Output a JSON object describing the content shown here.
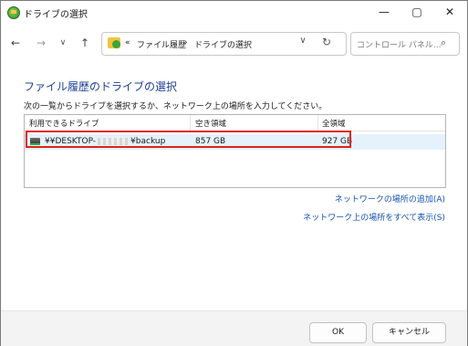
{
  "window": {
    "title": "ドライブの選択"
  },
  "nav": {
    "address_prefix": "«",
    "breadcrumb": [
      "ファイル履歴",
      "ドライブの選択"
    ],
    "breadcrumb_sep": "›",
    "search_placeholder": "コントロール パネル..."
  },
  "main": {
    "heading": "ファイル履歴のドライブの選択",
    "instruction": "次の一覧からドライブを選択するか、ネットワーク上の場所を入力してください。",
    "columns": [
      "利用できるドライブ",
      "空き領域",
      "全領域"
    ],
    "rows": [
      {
        "name_prefix": "¥¥DESKTOP-",
        "name_suffix": "¥backup",
        "free": "857 GB",
        "total": "927 GB"
      }
    ]
  },
  "links": {
    "add_network": "ネットワークの場所の追加(A)",
    "show_all_network": "ネットワーク上の場所をすべて表示(S)"
  },
  "footer": {
    "ok": "OK",
    "cancel": "キャンセル"
  },
  "colors": {
    "heading": "#1c3f95",
    "link": "#1552b5",
    "highlight": "#e0241a",
    "selected_row": "#e5f1fb"
  }
}
